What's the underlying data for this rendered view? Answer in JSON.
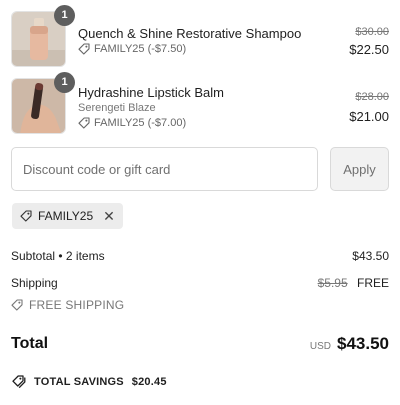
{
  "items": [
    {
      "quantity": "1",
      "name": "Quench & Shine Restorative Shampoo",
      "variant": "",
      "discount": "FAMILY25 (-$7.50)",
      "original_price": "$30.00",
      "price": "$22.50",
      "icon": "tag-icon"
    },
    {
      "quantity": "1",
      "name": "Hydrashine Lipstick Balm",
      "variant": "Serengeti Blaze",
      "discount": "FAMILY25 (-$7.00)",
      "original_price": "$28.00",
      "price": "$21.00",
      "icon": "tag-icon"
    }
  ],
  "discount_field": {
    "placeholder": "Discount code or gift card",
    "value": "",
    "apply_label": "Apply"
  },
  "applied_code": {
    "code": "FAMILY25",
    "remove_icon": "close-icon"
  },
  "summary": {
    "subtotal_label": "Subtotal • 2 items",
    "subtotal_value": "$43.50",
    "shipping_label": "Shipping",
    "shipping_original": "$5.95",
    "shipping_value": "FREE",
    "free_shipping_note": "FREE SHIPPING",
    "total_label": "Total",
    "currency": "USD",
    "total_value": "$43.50",
    "savings_label": "TOTAL SAVINGS",
    "savings_value": "$20.45"
  },
  "colors": {
    "badge": "#5e5e5e",
    "chip_bg": "#ececec",
    "button_bg": "#f2f2f2",
    "muted_text": "#777777"
  }
}
